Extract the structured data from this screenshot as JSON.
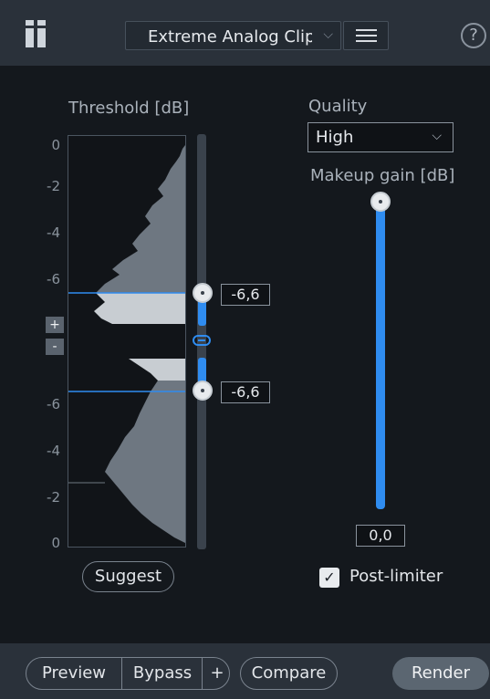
{
  "header": {
    "preset_name": "Extreme Analog Clipp",
    "preset_caret_icon": "chevron-down-icon",
    "menu_icon": "hamburger-menu-icon",
    "help_label": "?"
  },
  "threshold": {
    "label": "Threshold [dB]",
    "scale_ticks": [
      "0",
      "-2",
      "-4",
      "-6",
      "-6",
      "-4",
      "-2",
      "0"
    ],
    "upper_value": "-6,6",
    "lower_value": "-6,6",
    "plus_label": "+",
    "minus_label": "-",
    "suggest_label": "Suggest"
  },
  "quality": {
    "label": "Quality",
    "selected": "High"
  },
  "makeup": {
    "label": "Makeup gain [dB]",
    "value": "0,0"
  },
  "post_limiter": {
    "label": "Post-limiter",
    "checked": true,
    "check_glyph": "✓"
  },
  "footer": {
    "preview_label": "Preview",
    "bypass_label": "Bypass",
    "plus_label": "+",
    "compare_label": "Compare",
    "render_label": "Render"
  },
  "colors": {
    "accent": "#2f8cf0",
    "panel_bg": "#14181d",
    "bar_bg": "#2a313a"
  }
}
